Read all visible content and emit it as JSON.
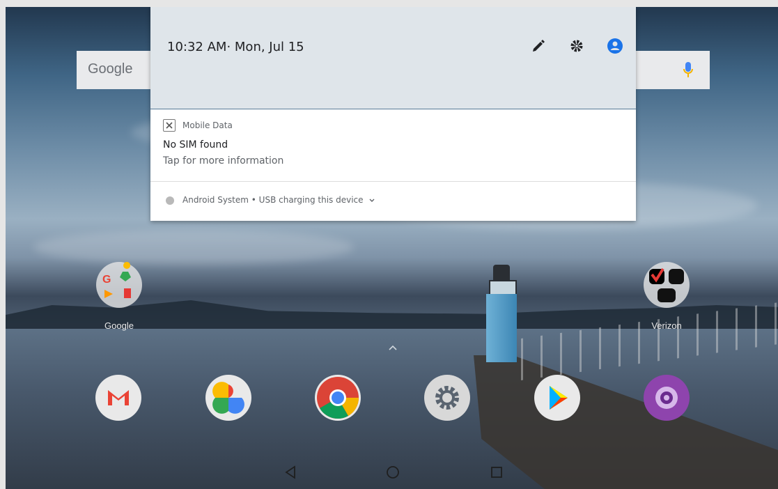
{
  "status": {
    "time": "10:32 AM",
    "date": "· Mon, Jul 15"
  },
  "quick_settings": {
    "icons": [
      "edit-icon",
      "settings-icon",
      "account-icon"
    ],
    "accent_color": "#1a73e8"
  },
  "search_bar": {
    "logo_text": "Google"
  },
  "notifications": [
    {
      "app_name": "Mobile Data",
      "title": "No SIM found",
      "text": "Tap for more information"
    },
    {
      "summary": "Android System • USB charging this device"
    }
  ],
  "home": {
    "folders": [
      {
        "label": "Google"
      },
      {
        "label": "Verizon"
      }
    ],
    "dock": [
      "gmail-icon",
      "photos-icon",
      "chrome-icon",
      "settings-app-icon",
      "play-store-icon",
      "camera-icon"
    ]
  },
  "nav": [
    "back-icon",
    "home-icon",
    "recents-icon"
  ]
}
